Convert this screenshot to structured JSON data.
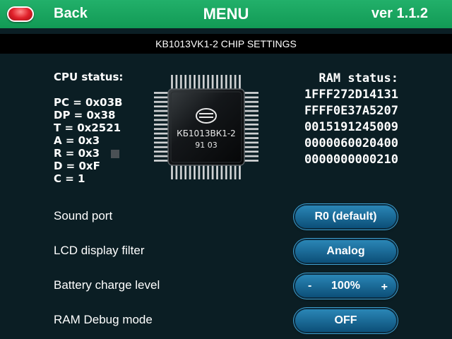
{
  "header": {
    "back_label": "Back",
    "title": "MENU",
    "version": "ver 1.1.2"
  },
  "subtitle": "KB1013VK1-2 CHIP SETTINGS",
  "cpu_status": {
    "title": "CPU status:",
    "lines": [
      "PC = 0x03B",
      "DP = 0x38",
      "T = 0x2521",
      "A = 0x3",
      "R = 0x3",
      "D = 0xF",
      "C = 1"
    ]
  },
  "chip": {
    "name": "КБ1013ВК1-2",
    "date_code": "91 03",
    "logo": "C"
  },
  "ram_status": {
    "title": "RAM status:",
    "lines": [
      "1FFF272D14131",
      "FFFF0E37A5207",
      "0015191245009",
      "0000060020400",
      "0000000000210"
    ]
  },
  "settings": [
    {
      "label": "Sound port",
      "value": "R0 (default)"
    },
    {
      "label": "LCD display filter",
      "value": "Analog"
    },
    {
      "label": "Battery charge level",
      "value": "100%",
      "minus": "-",
      "plus": "+"
    },
    {
      "label": "RAM Debug mode",
      "value": "OFF"
    }
  ],
  "colors": {
    "header_bg": "#1aa55f",
    "background": "#0b1e24",
    "pill": "#1a6a9a",
    "back_button": "#e0202a"
  }
}
